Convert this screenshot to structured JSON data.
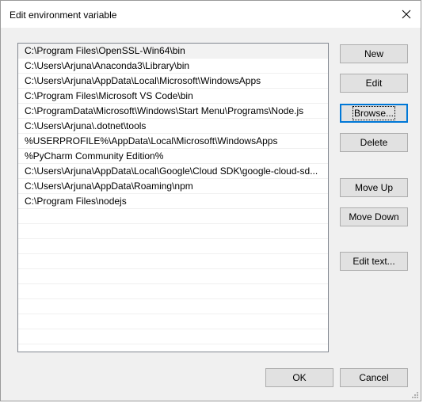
{
  "window": {
    "title": "Edit environment variable"
  },
  "paths": [
    "C:\\Program Files\\OpenSSL-Win64\\bin",
    "C:\\Users\\Arjuna\\Anaconda3\\Library\\bin",
    "C:\\Users\\Arjuna\\AppData\\Local\\Microsoft\\WindowsApps",
    "C:\\Program Files\\Microsoft VS Code\\bin",
    "C:\\ProgramData\\Microsoft\\Windows\\Start Menu\\Programs\\Node.js",
    "C:\\Users\\Arjuna\\.dotnet\\tools",
    "%USERPROFILE%\\AppData\\Local\\Microsoft\\WindowsApps",
    "%PyCharm Community Edition%",
    "C:\\Users\\Arjuna\\AppData\\Local\\Google\\Cloud SDK\\google-cloud-sd...",
    "C:\\Users\\Arjuna\\AppData\\Roaming\\npm",
    "C:\\Program Files\\nodejs"
  ],
  "buttons": {
    "new": "New",
    "edit": "Edit",
    "browse": "Browse...",
    "delete": "Delete",
    "move_up": "Move Up",
    "move_down": "Move Down",
    "edit_text": "Edit text...",
    "ok": "OK",
    "cancel": "Cancel"
  },
  "colors": {
    "selected_row": "#f2f2f2",
    "focus_border": "#0078d7",
    "button_face": "#e1e1e1"
  }
}
